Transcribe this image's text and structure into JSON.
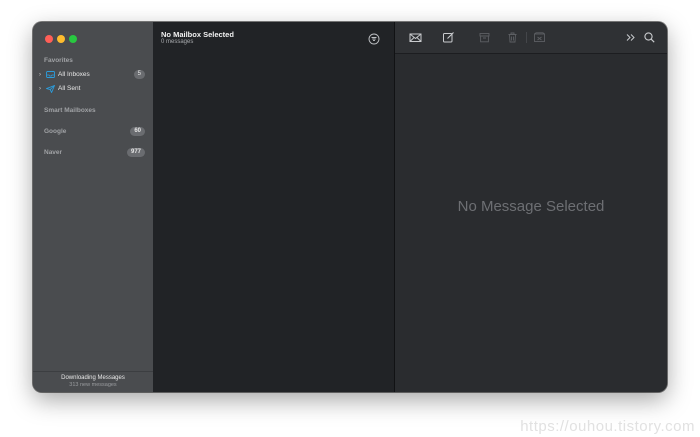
{
  "sidebar": {
    "favorites_label": "Favorites",
    "favorites": [
      {
        "label": "All Inboxes",
        "icon": "inbox-icon",
        "badge": "5"
      },
      {
        "label": "All Sent",
        "icon": "paper-plane-icon"
      }
    ],
    "smart_mailboxes_label": "Smart Mailboxes",
    "accounts": [
      {
        "label": "Google",
        "badge": "60"
      },
      {
        "label": "Naver",
        "badge": "977"
      }
    ],
    "footer": {
      "title": "Downloading Messages",
      "subtitle": "313 new messages"
    }
  },
  "message_list": {
    "title": "No Mailbox Selected",
    "subtitle": "0 messages"
  },
  "viewer": {
    "empty_text": "No Message Selected"
  },
  "watermark": "https://ouhou.tistory.com",
  "colors": {
    "sidebar_bg": "#4a4c4f",
    "list_bg": "#212326",
    "viewer_bg": "#2a2c2f",
    "accent": "#2c9cdb"
  }
}
